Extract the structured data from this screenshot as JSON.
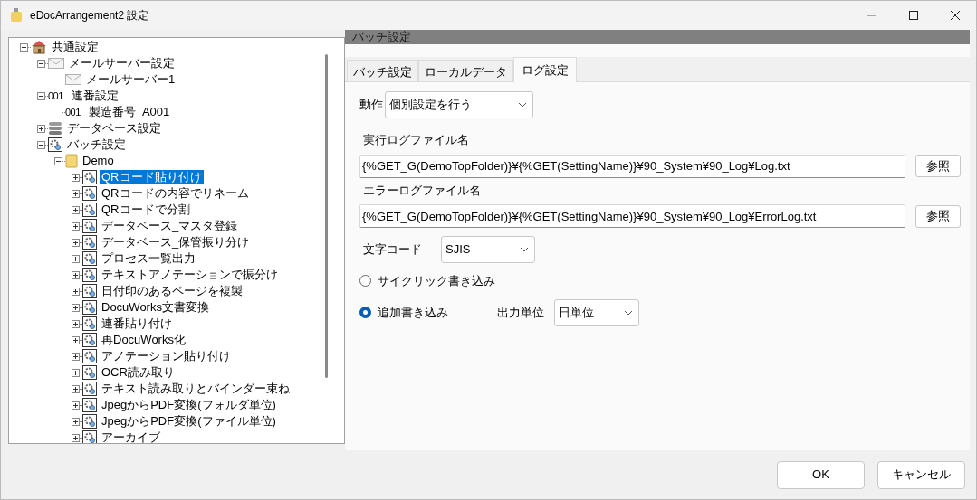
{
  "window": {
    "title": "eDocArrangement2 設定"
  },
  "tree": [
    {
      "label": "共通設定",
      "kind": "house",
      "expanded": true,
      "selected": false,
      "children": [
        {
          "label": "メールサーバー設定",
          "kind": "mail",
          "expanded": true,
          "selected": false,
          "children": [
            {
              "label": "メールサーバー1",
              "kind": "mail",
              "selected": false
            }
          ]
        },
        {
          "label": "連番設定",
          "kind": "counter",
          "badge": "001",
          "expanded": true,
          "selected": false,
          "children": [
            {
              "label": "製造番号_A001",
              "kind": "counter",
              "badge": "001",
              "selected": false
            }
          ]
        },
        {
          "label": "データベース設定",
          "kind": "database",
          "expanded": false,
          "selected": false
        },
        {
          "label": "バッチ設定",
          "kind": "batch",
          "expanded": true,
          "selected": false,
          "children": [
            {
              "label": "Demo",
              "kind": "folder",
              "expanded": true,
              "selected": false,
              "children": [
                {
                  "label": "QRコード貼り付け",
                  "kind": "batch",
                  "expanded": false,
                  "selected": true
                },
                {
                  "label": "QRコードの内容でリネーム",
                  "kind": "batch",
                  "expanded": false,
                  "selected": false
                },
                {
                  "label": "QRコードで分割",
                  "kind": "batch",
                  "expanded": false,
                  "selected": false
                },
                {
                  "label": "データベース_マスタ登録",
                  "kind": "batch",
                  "expanded": false,
                  "selected": false
                },
                {
                  "label": "データベース_保管振り分け",
                  "kind": "batch",
                  "expanded": false,
                  "selected": false
                },
                {
                  "label": "プロセス一覧出力",
                  "kind": "batch",
                  "expanded": false,
                  "selected": false
                },
                {
                  "label": "テキストアノテーションで振分け",
                  "kind": "batch",
                  "expanded": false,
                  "selected": false
                },
                {
                  "label": "日付印のあるページを複製",
                  "kind": "batch",
                  "expanded": false,
                  "selected": false
                },
                {
                  "label": "DocuWorks文書変換",
                  "kind": "batch",
                  "expanded": false,
                  "selected": false
                },
                {
                  "label": "連番貼り付け",
                  "kind": "batch",
                  "expanded": false,
                  "selected": false
                },
                {
                  "label": "再DocuWorks化",
                  "kind": "batch",
                  "expanded": false,
                  "selected": false
                },
                {
                  "label": "アノテーション貼り付け",
                  "kind": "batch",
                  "expanded": false,
                  "selected": false
                },
                {
                  "label": "OCR読み取り",
                  "kind": "batch",
                  "expanded": false,
                  "selected": false
                },
                {
                  "label": "テキスト読み取りとバインダー束ね",
                  "kind": "batch",
                  "expanded": false,
                  "selected": false
                },
                {
                  "label": "JpegからPDF変換(フォルダ単位)",
                  "kind": "batch",
                  "expanded": false,
                  "selected": false
                },
                {
                  "label": "JpegからPDF変換(ファイル単位)",
                  "kind": "batch",
                  "expanded": false,
                  "selected": false
                },
                {
                  "label": "アーカイブ",
                  "kind": "batch",
                  "expanded": false,
                  "selected": false
                }
              ]
            }
          ]
        }
      ]
    }
  ],
  "panel": {
    "header": "バッチ設定",
    "tabs": [
      {
        "label": "バッチ設定",
        "selected": false
      },
      {
        "label": "ローカルデータ",
        "selected": false
      },
      {
        "label": "ログ設定",
        "selected": true
      }
    ],
    "action": {
      "label": "動作",
      "value": "個別設定を行う"
    },
    "run_log": {
      "label": "実行ログファイル名",
      "value": "{%GET_G(DemoTopFolder)}¥{%GET(SettingName)}¥90_System¥90_Log¥Log.txt",
      "button": "参照"
    },
    "error_log": {
      "label": "エラーログファイル名",
      "value": "{%GET_G(DemoTopFolder)}¥{%GET(SettingName)}¥90_System¥90_Log¥ErrorLog.txt",
      "button": "参照"
    },
    "encoding": {
      "label": "文字コード",
      "value": "SJIS"
    },
    "write_modes": [
      {
        "label": "サイクリック書き込み",
        "selected": false
      },
      {
        "label": "追加書き込み",
        "selected": true
      }
    ],
    "output_unit": {
      "label": "出力単位",
      "value": "日単位"
    }
  },
  "buttons": [
    "OK",
    "キャンセル"
  ]
}
